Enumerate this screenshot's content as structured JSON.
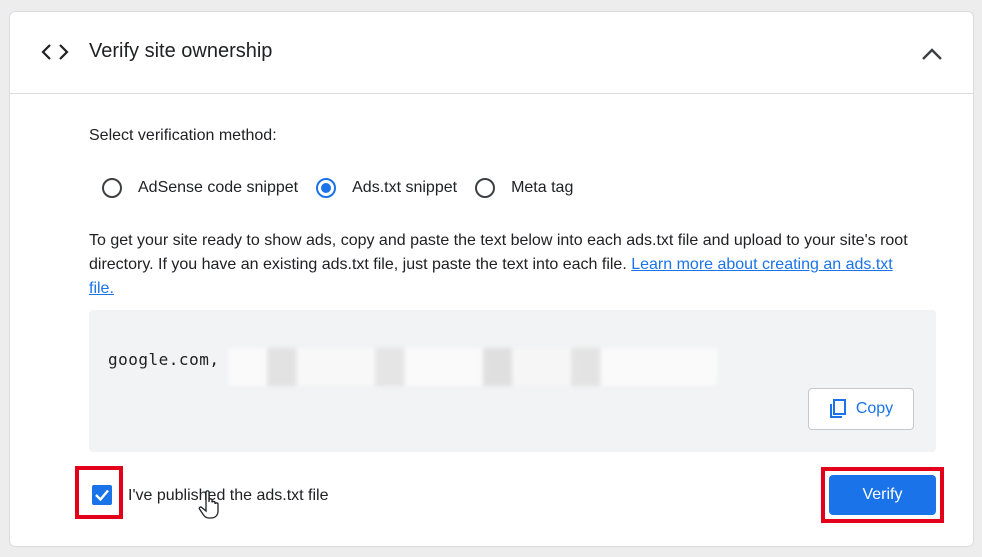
{
  "header": {
    "title": "Verify site ownership",
    "left_icon": "code-icon",
    "right_icon": "chevron-up-icon"
  },
  "method": {
    "label": "Select verification method:",
    "options": [
      {
        "label": "AdSense code snippet",
        "selected": false
      },
      {
        "label": "Ads.txt snippet",
        "selected": true
      },
      {
        "label": "Meta tag",
        "selected": false
      }
    ]
  },
  "description": {
    "text": "To get your site ready to show ads, copy and paste the text below into each ads.txt file and upload to your site's root directory. If you have an existing ads.txt file, just paste the text into each file. ",
    "link": "Learn more about creating an ads.txt file."
  },
  "snippet": {
    "visible_text": "google.com,",
    "copy_label": "Copy",
    "copy_icon": "copy-icon"
  },
  "confirm": {
    "checked": true,
    "label": "I've published the ads.txt file"
  },
  "actions": {
    "verify_label": "Verify"
  },
  "colors": {
    "accent": "#1a73e8",
    "highlight": "#e3001b"
  }
}
